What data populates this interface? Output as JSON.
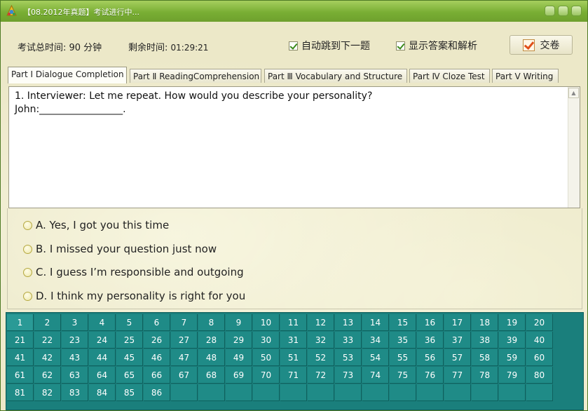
{
  "window": {
    "title": "【08.2012年真题】考试进行中..."
  },
  "info": {
    "total_label": "考试总时间: 90 分钟",
    "remain_label": "剩余时间:",
    "remain_value": "01:29:21"
  },
  "options_toggles": {
    "auto_next": "自动跳到下一题",
    "show_answers": "显示答案和解析"
  },
  "submit_label": "交卷",
  "tabs": [
    {
      "label": "Part Ⅰ Dialogue Completion",
      "active": true
    },
    {
      "label": "Part Ⅱ ReadingComprehension",
      "active": false
    },
    {
      "label": "Part Ⅲ Vocabulary and Structure",
      "active": false
    },
    {
      "label": "Part Ⅳ Cloze Test",
      "active": false
    },
    {
      "label": "Part Ⅴ Writing",
      "active": false
    }
  ],
  "question": {
    "line1": "1. Interviewer: Let me repeat. How would you describe your personality?",
    "line2": "John:_________________."
  },
  "answers": [
    "A. Yes, I got you this time",
    "B. I missed your question just now",
    "C. I guess I’m responsible and outgoing",
    "D. I think my personality is right for you"
  ],
  "question_grid": {
    "columns": 20,
    "numbers": [
      "1",
      "2",
      "3",
      "4",
      "5",
      "6",
      "7",
      "8",
      "9",
      "10",
      "11",
      "12",
      "13",
      "14",
      "15",
      "16",
      "17",
      "18",
      "19",
      "20",
      "21",
      "22",
      "23",
      "24",
      "25",
      "26",
      "27",
      "28",
      "29",
      "30",
      "31",
      "32",
      "33",
      "34",
      "35",
      "36",
      "37",
      "38",
      "39",
      "40",
      "41",
      "42",
      "43",
      "44",
      "45",
      "46",
      "47",
      "48",
      "49",
      "50",
      "51",
      "52",
      "53",
      "54",
      "55",
      "56",
      "57",
      "58",
      "59",
      "60",
      "61",
      "62",
      "63",
      "64",
      "65",
      "66",
      "67",
      "68",
      "69",
      "70",
      "71",
      "72",
      "73",
      "74",
      "75",
      "76",
      "77",
      "78",
      "79",
      "80",
      "81",
      "82",
      "83",
      "84",
      "85",
      "86"
    ],
    "current": "1"
  },
  "colors": {
    "titlebar": "#79ae34",
    "grid_bg": "#1a7f7c",
    "grid_cell": "#1f8b87"
  }
}
